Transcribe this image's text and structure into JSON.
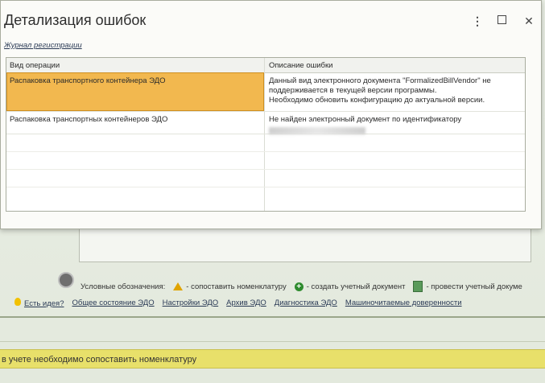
{
  "dialog": {
    "title": "Детализация ошибок",
    "journal_link": "Журнал регистрации",
    "columns": [
      "Вид операции",
      "Описание ошибки"
    ],
    "rows": [
      {
        "operation": "Распаковка транспортного контейнера ЭДО",
        "description_lines": [
          "Данный вид электронного документа \"FormalizedBillVendor\" не",
          "поддерживается в текущей версии программы.",
          "Необходимо обновить конфигурацию до актуальной версии."
        ],
        "selected": true
      },
      {
        "operation": "Распаковка транспортных контейнеров ЭДО",
        "description_lines": [
          "Не найден электронный документ по идентификатору"
        ],
        "selected": false
      }
    ]
  },
  "background": {
    "legend_label": "Условные обозначения:",
    "legend_items": [
      {
        "icon": "warning-icon",
        "text": "- сопоставить номенклатуру"
      },
      {
        "icon": "plus-circle-icon",
        "text": "- создать учетный документ"
      },
      {
        "icon": "document-icon",
        "text": "- провести учетный докуме"
      }
    ],
    "links": [
      "Есть идея?",
      "Общее состояние ЭДО",
      "Настройки ЭДО",
      "Архив ЭДО",
      "Диагностика ЭДО",
      "Машиночитаемые доверенности"
    ],
    "status_text": "в учете необходимо сопоставить номенклатуру"
  },
  "colors": {
    "selected_row": "#f2b84f",
    "status_bar": "#e8e06a"
  }
}
